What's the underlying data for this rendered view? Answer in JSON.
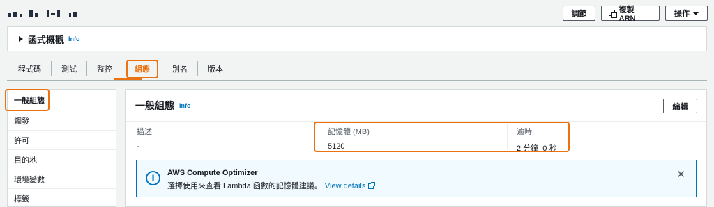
{
  "header": {
    "buttons": {
      "adjust": "調節",
      "copy_arn": "複製 ARN",
      "actions": "操作"
    }
  },
  "overview": {
    "title": "函式概觀",
    "info": "Info"
  },
  "tabs": [
    {
      "label": "程式碼"
    },
    {
      "label": "測試"
    },
    {
      "label": "監控"
    },
    {
      "label": "組態",
      "active": true
    },
    {
      "label": "別名"
    },
    {
      "label": "版本"
    }
  ],
  "sidenav": {
    "items": [
      {
        "label": "一般組態",
        "active": true
      },
      {
        "label": "觸發"
      },
      {
        "label": "許可"
      },
      {
        "label": "目的地"
      },
      {
        "label": "環境變數"
      },
      {
        "label": "標籤"
      }
    ]
  },
  "general": {
    "title": "一般組態",
    "info": "Info",
    "edit_label": "編輯",
    "description": {
      "label": "描述",
      "value": "-"
    },
    "memory": {
      "label": "記憶體 (MB)",
      "value": "5120"
    },
    "timeout": {
      "label": "逾時",
      "value": "2 分鐘  0 秒"
    }
  },
  "alert": {
    "title": "AWS Compute Optimizer",
    "text": "選擇使用來查看 Lambda 函數的記憶體建議。",
    "link": "View details"
  },
  "colors": {
    "accent": "#ec7211",
    "link": "#0073bb",
    "info_bg": "#f1faff"
  }
}
